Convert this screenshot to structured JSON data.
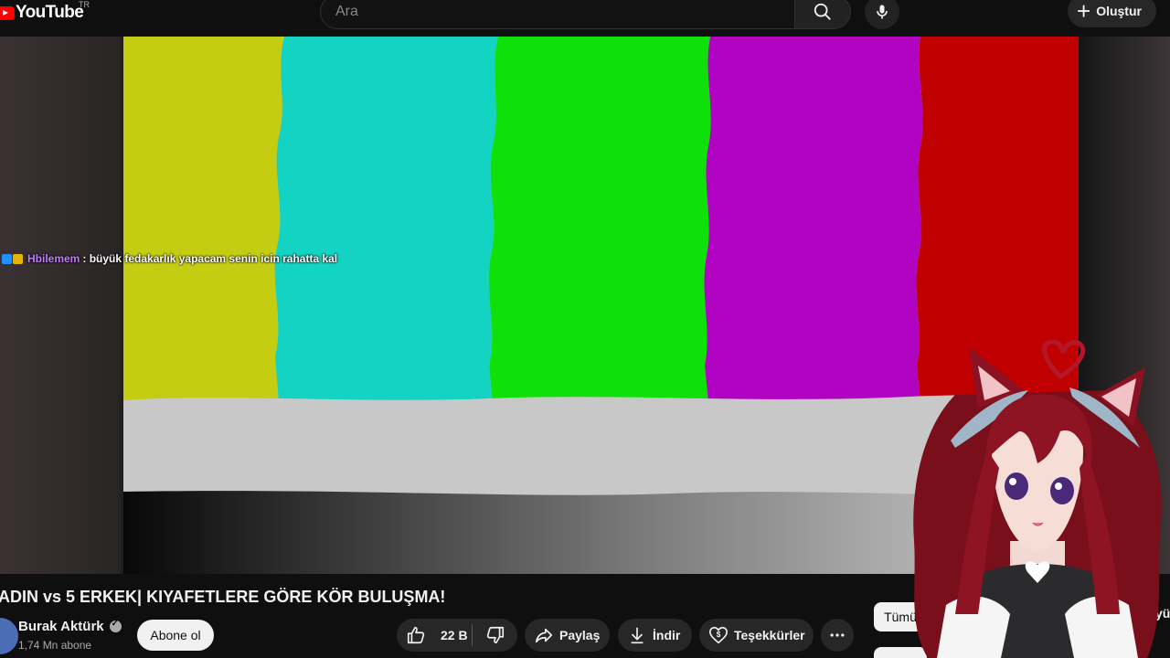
{
  "header": {
    "logo_text": "YouTube",
    "logo_country": "TR",
    "search_placeholder": "Ara",
    "create_label": "Oluştur"
  },
  "icons": {
    "search": "search-icon",
    "mic": "mic-icon",
    "create": "plus-icon",
    "like": "thumbs-up-icon",
    "dislike": "thumbs-down-icon",
    "share": "share-icon",
    "download": "download-icon",
    "thanks": "heart-dollar-icon",
    "more": "more-horiz-icon",
    "verified": "verified-check-icon"
  },
  "video": {
    "chat_user": "Hbilemem",
    "chat_message": ": büyük fedakarlık yapacam senin icin rahatta kal",
    "title": "ADIN vs 5 ERKEK| KIYAFETLERE GÖRE KÖR BULUŞMA!"
  },
  "channel": {
    "name": "Burak Aktürk",
    "subscribers": "1,74 Mn abone",
    "subscribe_label": "Abone ol"
  },
  "actions": {
    "likes": "22 B",
    "share_label": "Paylaş",
    "download_label": "İndir",
    "thanks_label": "Teşekkürler"
  },
  "sidebar": {
    "chip_all": "Tümü",
    "chip_partial": "adlı yü"
  },
  "colors": {
    "bars": [
      "#c5cd12",
      "#13d3c2",
      "#10e00a",
      "#b004c2",
      "#c00000"
    ],
    "gray_band": "#c8c8c8",
    "background": "#0f0f0f",
    "pill": "#272727",
    "chat_user": "#c37cff"
  }
}
